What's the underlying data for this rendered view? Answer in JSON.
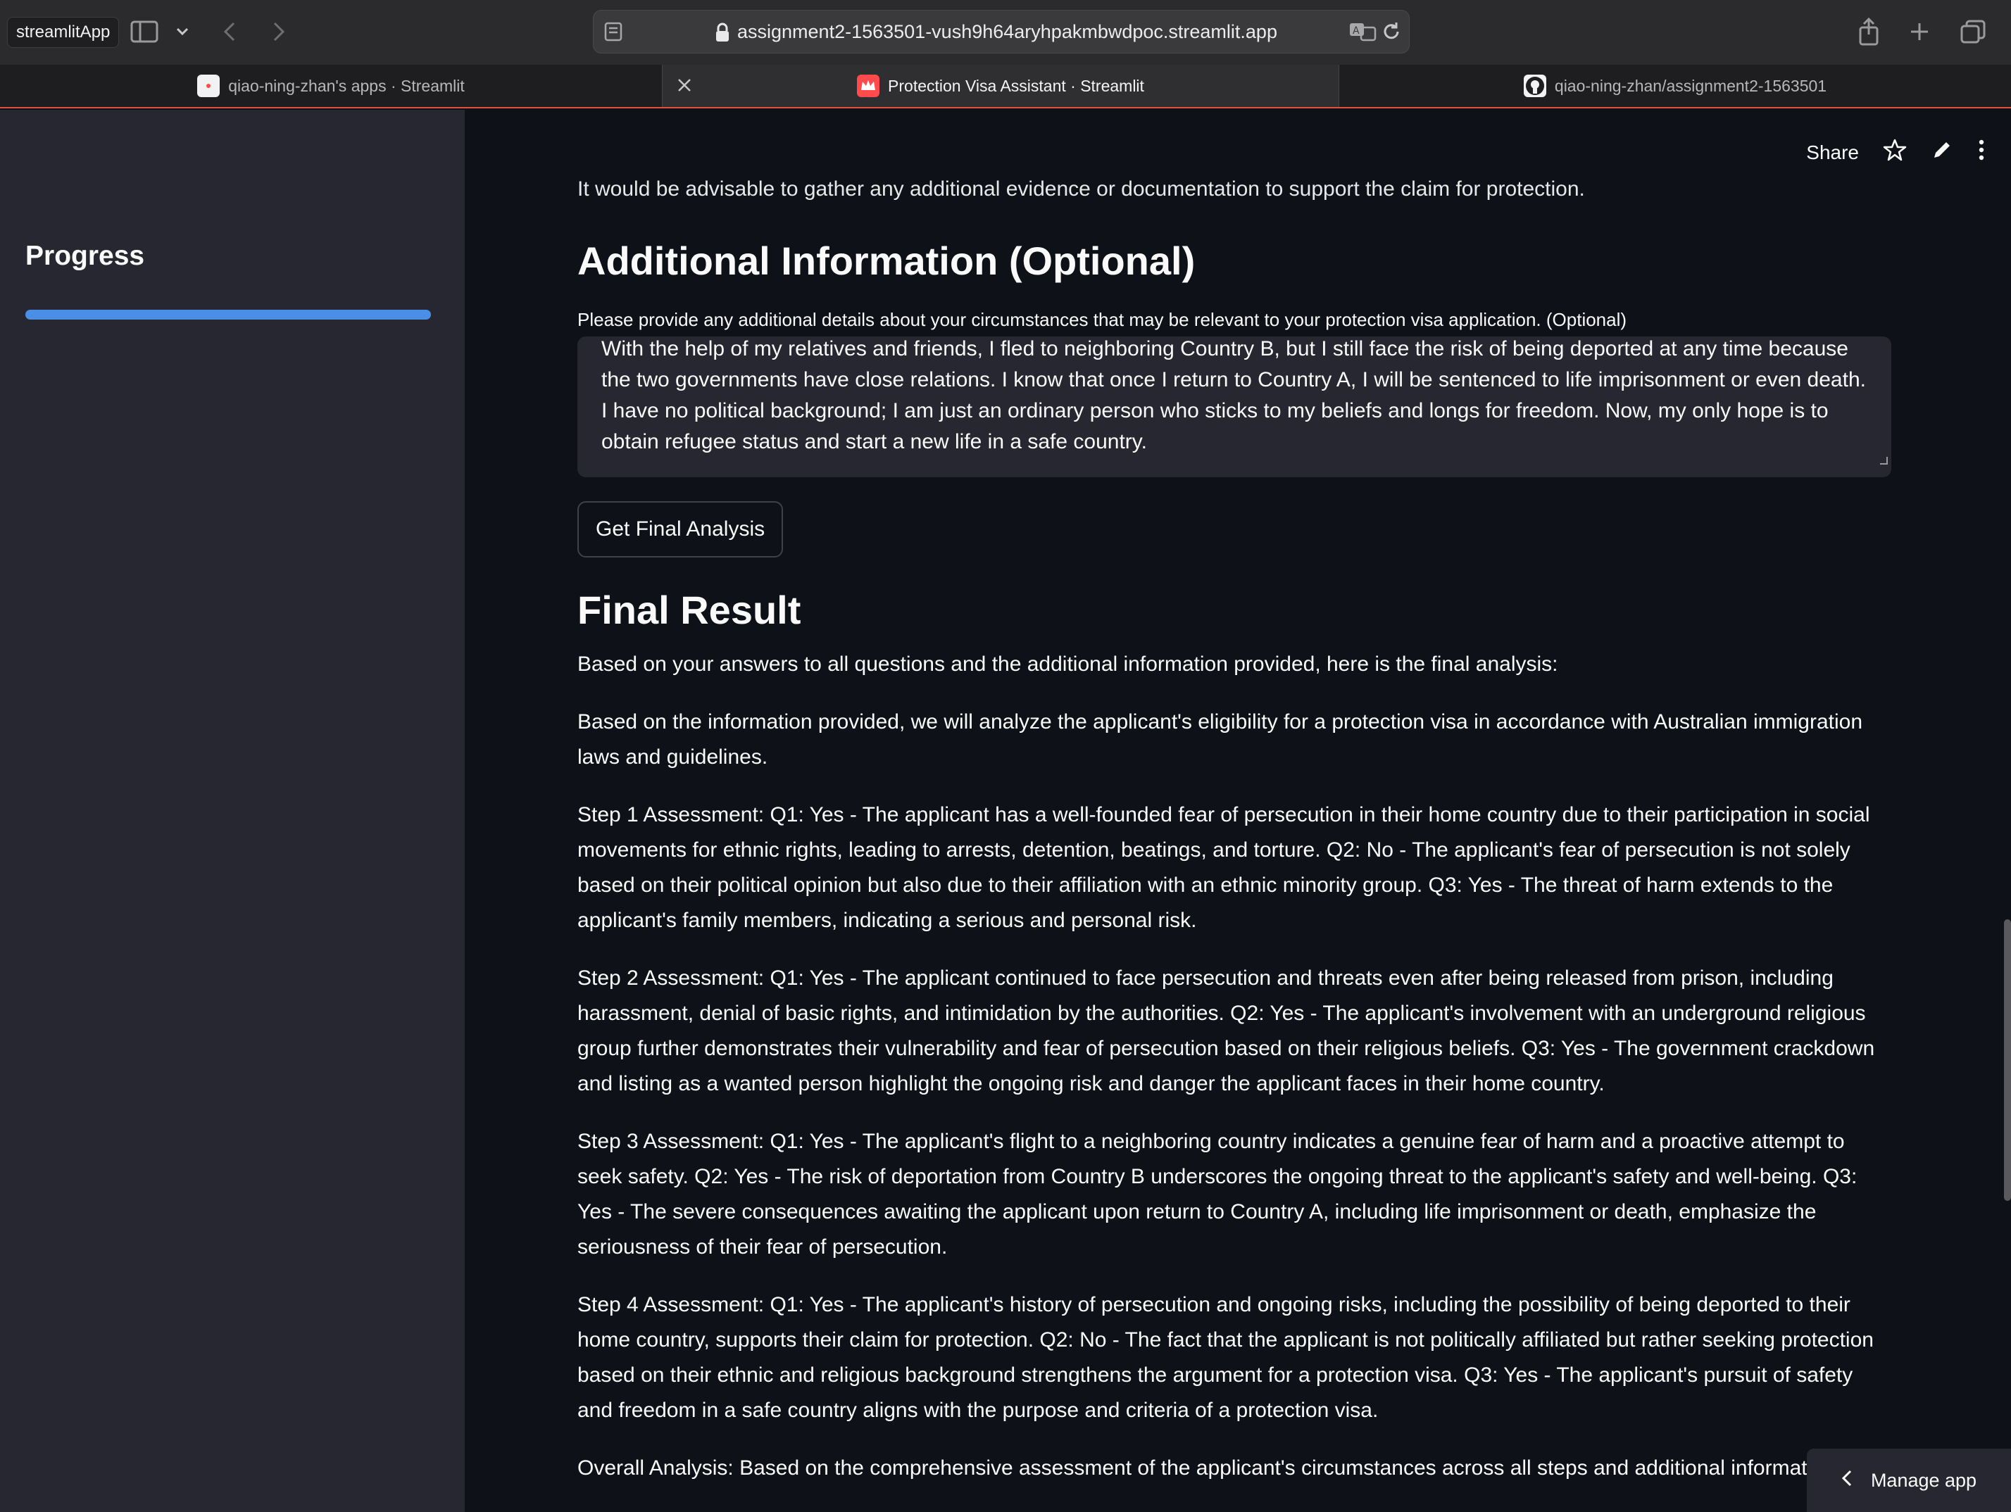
{
  "browser": {
    "app_label": "streamlitApp",
    "url": "assignment2-1563501-vush9h64aryhpakmbwdpoc.streamlit.app",
    "tabs": [
      {
        "label": "qiao-ning-zhan's apps · Streamlit",
        "active": false
      },
      {
        "label": "Protection Visa Assistant · Streamlit",
        "active": true
      },
      {
        "label": "qiao-ning-zhan/assignment2-1563501",
        "active": false
      }
    ]
  },
  "sidebar": {
    "title": "Progress",
    "progress": 1.0,
    "progress_color": "#4a8ee8"
  },
  "header": {
    "share_label": "Share",
    "icons": [
      "star-icon",
      "pencil-icon",
      "more-vert-icon"
    ]
  },
  "main": {
    "clipped_text": "It would be advisable to gather any additional evidence or documentation to support the claim for protection.",
    "additional_heading": "Additional Information (Optional)",
    "textarea_label": "Please provide any additional details about your circumstances that may be relevant to your protection visa application. (Optional)",
    "textarea_value": "With the help of my relatives and friends, I fled to neighboring Country B, but I still face the risk of being deported at any time because the two governments have close relations. I know that once I return to Country A, I will be sentenced to life imprisonment or even death. I have no political background; I am just an ordinary person who sticks to my beliefs and longs for freedom. Now, my only hope is to obtain refugee status and start a new life in a safe country.",
    "button_label": "Get Final Analysis",
    "result_heading": "Final Result",
    "paragraphs": [
      "Based on your answers to all questions and the additional information provided, here is the final analysis:",
      "Based on the information provided, we will analyze the applicant's eligibility for a protection visa in accordance with Australian immigration laws and guidelines.",
      "Step 1 Assessment: Q1: Yes - The applicant has a well-founded fear of persecution in their home country due to their participation in social movements for ethnic rights, leading to arrests, detention, beatings, and torture. Q2: No - The applicant's fear of persecution is not solely based on their political opinion but also due to their affiliation with an ethnic minority group. Q3: Yes - The threat of harm extends to the applicant's family members, indicating a serious and personal risk.",
      "Step 2 Assessment: Q1: Yes - The applicant continued to face persecution and threats even after being released from prison, including harassment, denial of basic rights, and intimidation by the authorities. Q2: Yes - The applicant's involvement with an underground religious group further demonstrates their vulnerability and fear of persecution based on their religious beliefs. Q3: Yes - The government crackdown and listing as a wanted person highlight the ongoing risk and danger the applicant faces in their home country.",
      "Step 3 Assessment: Q1: Yes - The applicant's flight to a neighboring country indicates a genuine fear of harm and a proactive attempt to seek safety. Q2: Yes - The risk of deportation from Country B underscores the ongoing threat to the applicant's safety and well-being. Q3: Yes - The severe consequences awaiting the applicant upon return to Country A, including life imprisonment or death, emphasize the seriousness of their fear of persecution.",
      "Step 4 Assessment: Q1: Yes - The applicant's history of persecution and ongoing risks, including the possibility of being deported to their home country, supports their claim for protection. Q2: No - The fact that the applicant is not politically affiliated but rather seeking protection based on their ethnic and religious background strengthens the argument for a protection visa. Q3: Yes - The applicant's pursuit of safety and freedom in a safe country aligns with the purpose and criteria of a protection visa.",
      "Overall Analysis: Based on the comprehensive assessment of the applicant's circumstances across all steps and additional informati"
    ]
  },
  "manage_app": {
    "label": "Manage app"
  }
}
